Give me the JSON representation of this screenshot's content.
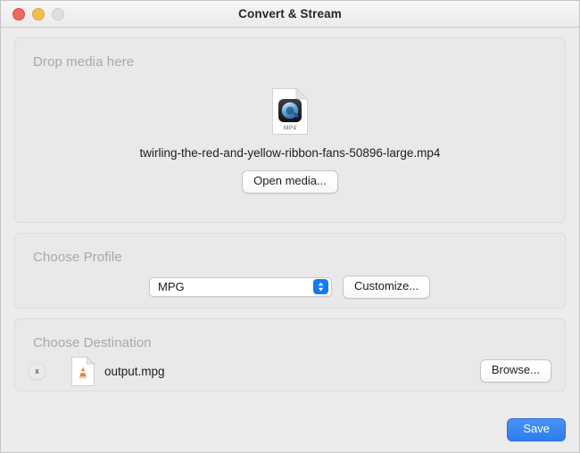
{
  "window": {
    "title": "Convert & Stream",
    "traffic_lights": [
      {
        "name": "close-button",
        "color": "#ec6a5f"
      },
      {
        "name": "minimize-button",
        "color": "#f5bd4f"
      },
      {
        "name": "zoom-button",
        "color": "#dedede"
      }
    ]
  },
  "drop_media": {
    "section_title": "Drop media here",
    "file_icon_label": "MP4",
    "file_icon_kind": "quicktime-document-icon",
    "filename": "twirling-the-red-and-yellow-ribbon-fans-50896-large.mp4",
    "open_button_label": "Open media..."
  },
  "profile": {
    "section_title": "Choose Profile",
    "selected": "MPG",
    "stepper_icon": "chevron-up-down-icon",
    "stepper_color": "#107bf5",
    "customize_button_label": "Customize..."
  },
  "destination": {
    "section_title": "Choose Destination",
    "remove_icon": "x",
    "file_icon_kind": "vlc-cone-document-icon",
    "filename": "output.mpg",
    "browse_button_label": "Browse..."
  },
  "footer": {
    "save_button_label": "Save",
    "save_accent_color": "#2d7cf0"
  }
}
